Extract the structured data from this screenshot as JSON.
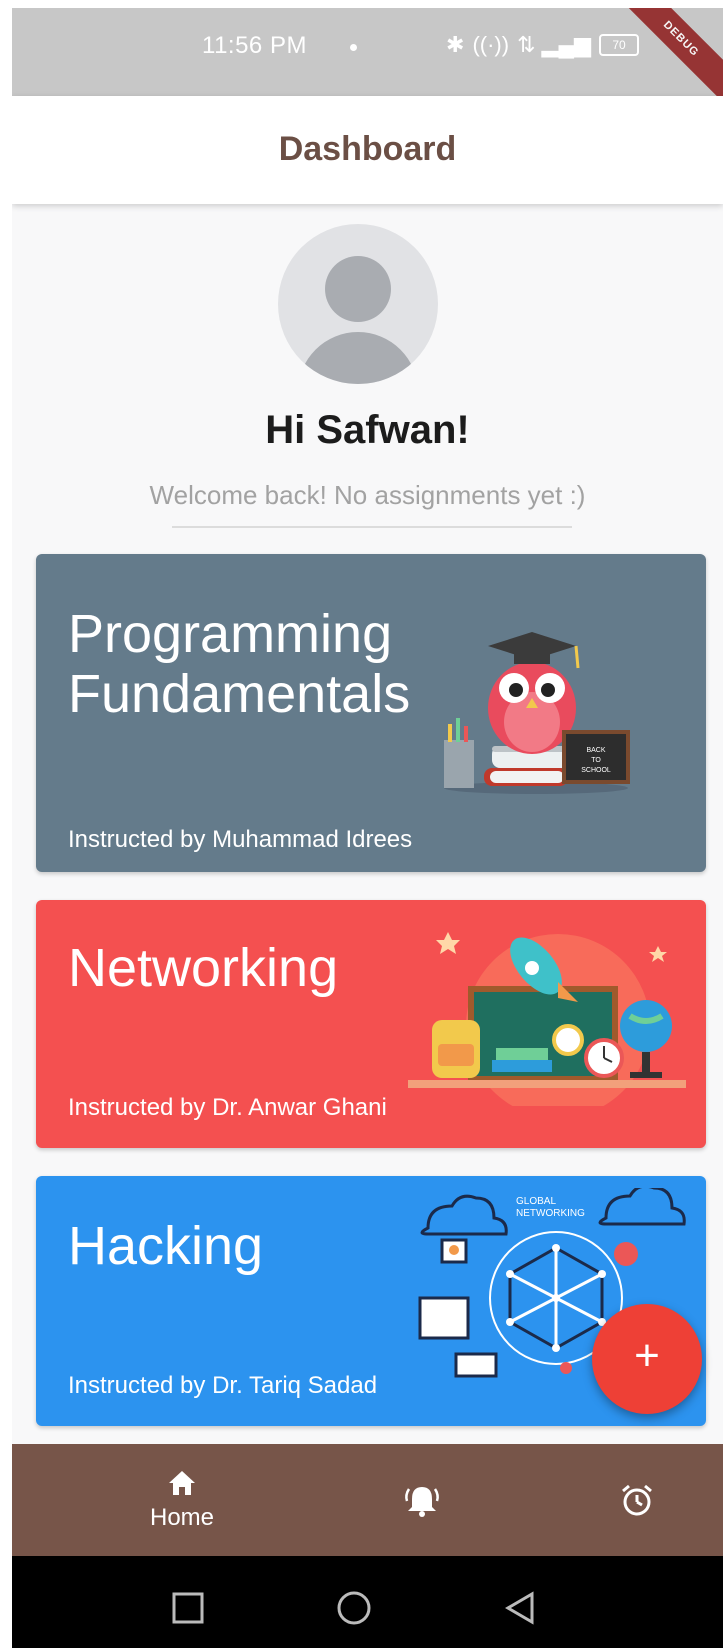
{
  "status_bar": {
    "time": "11:56 PM",
    "battery": "70",
    "debug_banner": "DEBUG"
  },
  "app_bar": {
    "title": "Dashboard"
  },
  "profile": {
    "greeting": "Hi Safwan!",
    "subtitle": "Welcome back! No assignments yet :)"
  },
  "courses": [
    {
      "title": "Programming Fundamentals",
      "instructor": "Instructed by Muhammad Idrees",
      "color": "#647b8b",
      "illustration": "owl-back-to-school"
    },
    {
      "title": "Networking",
      "instructor": "Instructed by Dr. Anwar Ghani",
      "color": "#f45050",
      "illustration": "school-supplies-rocket"
    },
    {
      "title": "Hacking",
      "instructor": "Instructed by Dr. Tariq Sadad",
      "color": "#2c93ef",
      "illustration": "global-networking"
    }
  ],
  "illustration_text": {
    "chalkboard": "BACK TO SCHOOL",
    "network": "GLOBAL NETWORKING"
  },
  "fab": {
    "icon": "plus-icon",
    "symbol": "+"
  },
  "bottom_nav": {
    "items": [
      {
        "label": "Home",
        "icon": "home-icon",
        "active": true
      },
      {
        "label": "",
        "icon": "bell-icon",
        "active": false
      },
      {
        "label": "",
        "icon": "alarm-clock-icon",
        "active": false
      }
    ],
    "color": "#775549"
  },
  "system_nav": {
    "icons": [
      "recents-square-icon",
      "home-circle-icon",
      "back-triangle-icon"
    ]
  }
}
